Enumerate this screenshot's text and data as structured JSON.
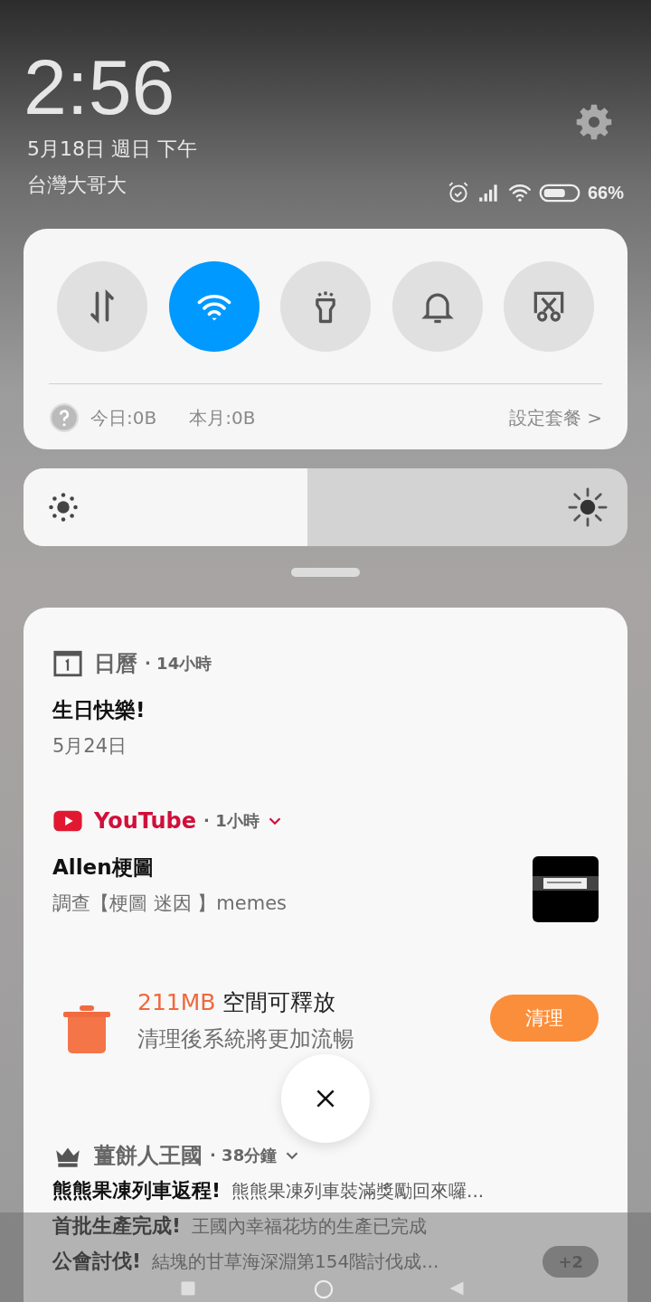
{
  "header": {
    "time": "2:56",
    "date": "5月18日 週日 下午",
    "carrier": "台灣大哥大",
    "battery": "66%"
  },
  "toggles": [
    {
      "kind": "data",
      "on": false
    },
    {
      "kind": "wifi",
      "on": true
    },
    {
      "kind": "flashlight",
      "on": false
    },
    {
      "kind": "bell",
      "on": false
    },
    {
      "kind": "screenshot",
      "on": false
    }
  ],
  "data_usage": {
    "today": "今日:0B",
    "month": "本月:0B",
    "plan_link": "設定套餐 >"
  },
  "brightness": {
    "level": 0.47
  },
  "notifications": [
    {
      "kind": "calendar",
      "app": "日曆",
      "time": "· 14小時",
      "expandable": false,
      "title": "生日快樂!",
      "text": "5月24日"
    },
    {
      "kind": "youtube",
      "app": "YouTube",
      "time": "· 1小時",
      "expandable": true,
      "title": "Allen梗圖",
      "text": "調查【梗圖 迷因 】memes"
    },
    {
      "kind": "cleaner",
      "size": "211MB",
      "title": " 空間可釋放",
      "text": "清理後系統將更加流暢",
      "button": "清理"
    },
    {
      "kind": "game",
      "app": "薑餅人王國",
      "time": "· 38分鐘",
      "expandable": true,
      "lines": [
        {
          "title": "熊熊果凍列車返程!",
          "text": "熊熊果凍列車裝滿獎勵回來囉..."
        },
        {
          "title": "首批生產完成!",
          "text": "王國內幸福花坊的生產已完成"
        },
        {
          "title": "公會討伐!",
          "text": "結塊的甘草海深淵第154階討伐成..."
        }
      ],
      "more": "+2"
    }
  ]
}
